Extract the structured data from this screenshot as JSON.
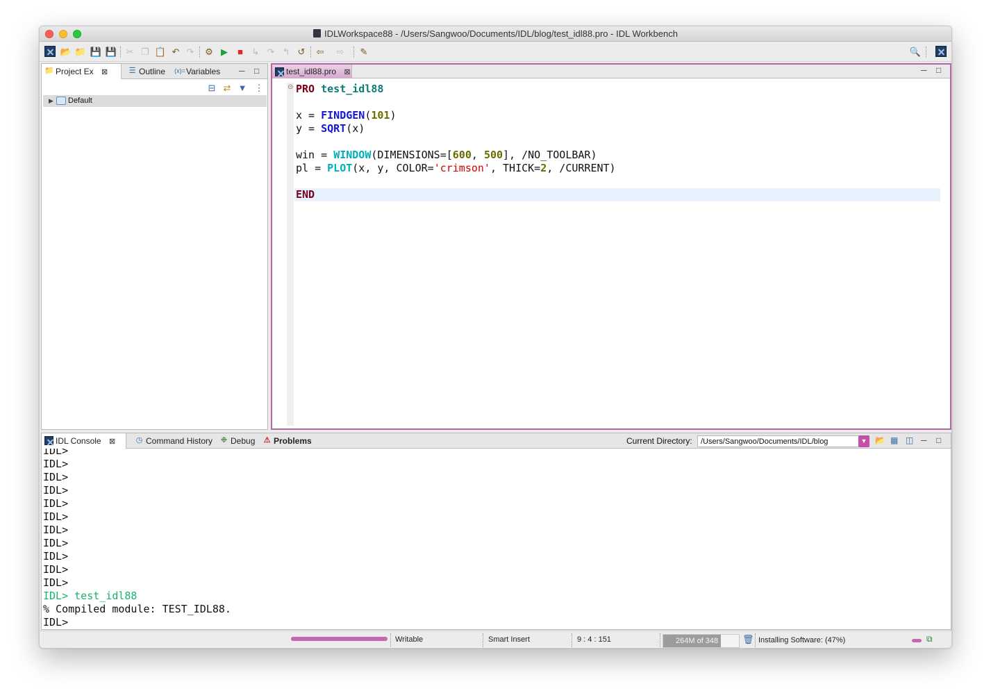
{
  "window": {
    "title": "IDLWorkspace88 - /Users/Sangwoo/Documents/IDL/blog/test_idl88.pro - IDL Workbench"
  },
  "toolbar": {
    "icons": [
      "idl-perspective-icon",
      "new-file-icon",
      "open-folder-icon",
      "save-icon",
      "save-all-icon",
      "cut-icon",
      "copy-icon",
      "paste-icon",
      "undo-icon",
      "redo-icon",
      "compile-icon",
      "run-icon",
      "stop-icon",
      "step-into-icon",
      "step-over-icon",
      "step-return-icon",
      "reset-icon",
      "back-icon",
      "forward-icon",
      "last-edit-icon",
      "search-icon",
      "idl-perspective-icon"
    ]
  },
  "left_panel": {
    "tabs": [
      {
        "label": "Project Ex",
        "active": true
      },
      {
        "label": "Outline",
        "active": false
      },
      {
        "label": "Variables",
        "active": false
      }
    ],
    "tree": [
      {
        "label": "Default"
      }
    ]
  },
  "editor": {
    "tab_label": "test_idl88.pro",
    "lines": [
      "PRO test_idl88",
      "",
      "x = FINDGEN(101)",
      "y = SQRT(x)",
      "",
      "win = WINDOW(DIMENSIONS=[600, 500], /NO_TOOLBAR)",
      "pl = PLOT(x, y, COLOR='crimson', THICK=2, /CURRENT)",
      "",
      "END"
    ]
  },
  "bottom_panel": {
    "tabs": [
      {
        "label": "IDL Console",
        "active": true
      },
      {
        "label": "Command History",
        "active": false
      },
      {
        "label": "Debug",
        "active": false
      },
      {
        "label": "Problems",
        "active": false
      }
    ],
    "current_directory_label": "Current Directory:",
    "current_directory_value": "/Users/Sangwoo/Documents/IDL/blog",
    "console_lines": [
      {
        "text": "IDL>",
        "color": "#111111"
      },
      {
        "text": "IDL>",
        "color": "#111111"
      },
      {
        "text": "IDL>",
        "color": "#111111"
      },
      {
        "text": "IDL>",
        "color": "#111111"
      },
      {
        "text": "IDL>",
        "color": "#111111"
      },
      {
        "text": "IDL>",
        "color": "#111111"
      },
      {
        "text": "IDL>",
        "color": "#111111"
      },
      {
        "text": "IDL>",
        "color": "#111111"
      },
      {
        "text": "IDL>",
        "color": "#111111"
      },
      {
        "text": "IDL>",
        "color": "#111111"
      },
      {
        "text": "IDL>",
        "color": "#111111"
      },
      {
        "text": "IDL> test_idl88",
        "color": "#19b36b"
      },
      {
        "text": "% Compiled module: TEST_IDL88.",
        "color": "#111111"
      },
      {
        "text": "IDL>",
        "color": "#111111"
      }
    ]
  },
  "status_bar": {
    "progress_fraction": 1.0,
    "mode": "Writable",
    "insert_mode": "Smart Insert",
    "position": "9 : 4 : 151",
    "heap": "264M of 348",
    "heap_fraction": 0.76,
    "task": "Installing Software: (47%)"
  },
  "colors": {
    "accent_pink": "#c566b0",
    "keyword_pro": "#7b0018",
    "function_blue": "#1515d8",
    "function_cyan": "#00aeb7",
    "number_olive": "#6b6b00",
    "string_red": "#d60000",
    "console_green": "#19b36b"
  }
}
